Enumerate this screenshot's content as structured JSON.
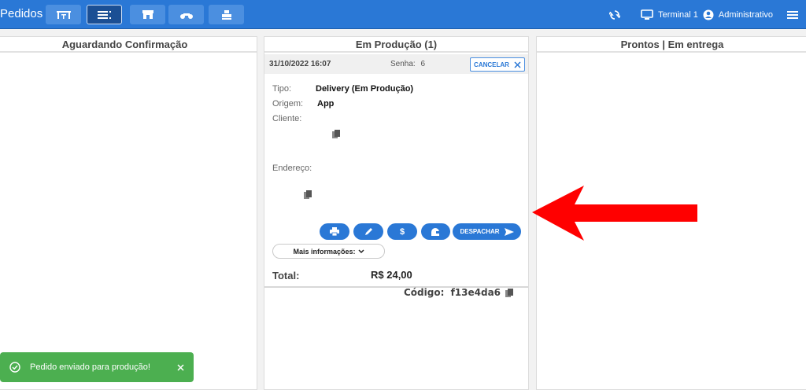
{
  "header": {
    "title": "Pedidos",
    "terminal": "Terminal 1",
    "user": "Administrativo"
  },
  "columns": [
    {
      "title": "Aguardando Confirmação"
    },
    {
      "title": "Em Produção (1)"
    },
    {
      "title": "Prontos | Em entrega"
    }
  ],
  "order": {
    "datetime": "31/10/2022 16:07",
    "senha_label": "Senha:",
    "senha": "6",
    "cancel_label": "CANCELAR",
    "tipo_label": "Tipo:",
    "tipo": "Delivery (Em Produção)",
    "origem_label": "Origem:",
    "origem": "App",
    "cliente_label": "Cliente:",
    "endereco_label": "Endereço:",
    "dispatch_label": "DESPACHAR",
    "more_label": "Mais informações:",
    "total_label": "Total:",
    "total": "R$ 24,00",
    "codigo_label": "Código:",
    "codigo": "f13e4da6",
    "pay_symbol": "$"
  },
  "toast": {
    "message": "Pedido enviado para produção!"
  },
  "colors": {
    "primary": "#2a78d6",
    "success": "#4caf50",
    "arrow": "#ff0000"
  }
}
